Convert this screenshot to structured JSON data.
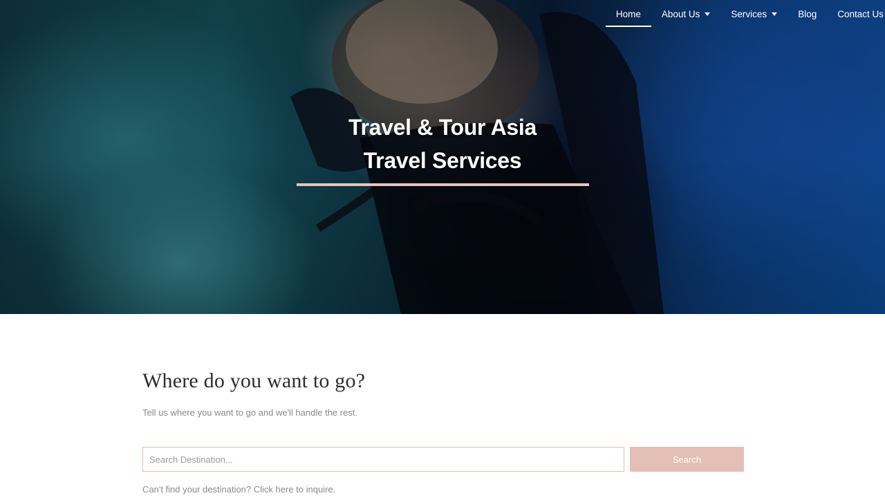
{
  "nav": {
    "items": [
      {
        "label": "Home",
        "active": true,
        "dropdown": false
      },
      {
        "label": "About Us",
        "active": false,
        "dropdown": true
      },
      {
        "label": "Services",
        "active": false,
        "dropdown": true
      },
      {
        "label": "Blog",
        "active": false,
        "dropdown": false
      },
      {
        "label": "Contact Us",
        "active": false,
        "dropdown": false
      }
    ]
  },
  "hero": {
    "title_line1": "Travel & Tour Asia",
    "title_line2": "Travel Services",
    "divider_color": "#e8c4bd",
    "background_image": "underwater scuba diver photo"
  },
  "search_section": {
    "heading": "Where do you want to go?",
    "subtext": "Tell us where you want to go and we'll handle the rest.",
    "input_placeholder": "Search Destination...",
    "input_value": "",
    "button_label": "Search",
    "inquire_text": "Can't find your destination? Click here to inquire."
  },
  "colors": {
    "accent": "#e3bfb6",
    "input_border": "#e3bcb4",
    "heading_text": "#2e2e2e",
    "muted_text": "#8a8a8a"
  }
}
